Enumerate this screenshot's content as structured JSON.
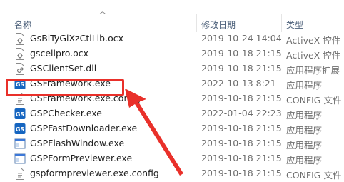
{
  "columns": {
    "name": "名称",
    "modified": "修改日期",
    "type": "类型"
  },
  "files": [
    {
      "name": "GsBiTyGlXzCtlLib.ocx",
      "modified": "2019-10-24 14:04",
      "type": "ActiveX 控件",
      "icon": "ocx-file-icon"
    },
    {
      "name": "gscellpro.ocx",
      "modified": "2019-10-18 21:15",
      "type": "ActiveX 控件",
      "icon": "ocx-file-icon"
    },
    {
      "name": "GSClientSet.dll",
      "modified": "2019-10-18 21:15",
      "type": "应用程序扩展",
      "icon": "dll-file-icon"
    },
    {
      "name": "GSFramework.exe",
      "modified": "2022-10-13 8:21",
      "type": "应用程序",
      "icon": "gs-app-icon"
    },
    {
      "name": "GSFramework.exe.config",
      "modified": "2019-10-18 21:15",
      "type": "CONFIG 文件",
      "icon": "config-file-icon"
    },
    {
      "name": "GSPChecker.exe",
      "modified": "2022-01-04 22:23",
      "type": "应用程序",
      "icon": "gs-app-icon"
    },
    {
      "name": "GSPFastDownloader.exe",
      "modified": "2019-10-18 21:15",
      "type": "应用程序",
      "icon": "gs-app-icon"
    },
    {
      "name": "GSPFlashWindow.exe",
      "modified": "2019-10-18 21:15",
      "type": "应用程序",
      "icon": "window-app-icon"
    },
    {
      "name": "GSPFormPreviewer.exe",
      "modified": "2019-10-18 21:15",
      "type": "应用程序",
      "icon": "window-app-icon"
    },
    {
      "name": "gspformpreviewer.exe.config",
      "modified": "2019-10-18 21:15",
      "type": "CONFIG 文件",
      "icon": "config-file-icon"
    }
  ],
  "colors": {
    "highlight": "#e9302a",
    "header_text": "#4c607a",
    "gs_icon": "#1565c0"
  }
}
